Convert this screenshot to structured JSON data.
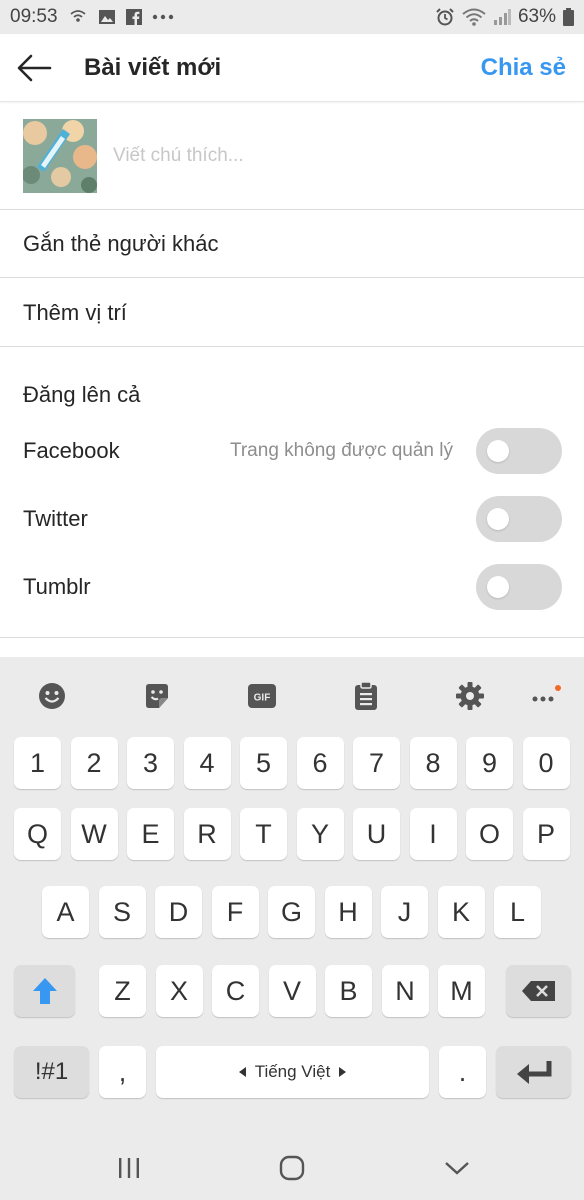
{
  "status_bar": {
    "time": "09:53",
    "battery": "63%",
    "icons_left": [
      "wifi-calling-icon",
      "gallery-icon",
      "facebook-icon",
      "more-notifications-icon"
    ],
    "icons_right": [
      "alarm-icon",
      "wifi-icon",
      "signal-icon",
      "battery-icon"
    ]
  },
  "header": {
    "title": "Bài viết mới",
    "share_label": "Chia sẻ",
    "accent_color": "#3897f0"
  },
  "caption": {
    "placeholder": "Viết chú thích..."
  },
  "rows": {
    "tag_people": "Gắn thẻ người khác",
    "add_location": "Thêm vị trí"
  },
  "share_section": {
    "title": "Đăng lên cả",
    "items": [
      {
        "label": "Facebook",
        "note": "Trang không được quản lý",
        "enabled": false
      },
      {
        "label": "Twitter",
        "note": "",
        "enabled": false
      },
      {
        "label": "Tumblr",
        "note": "",
        "enabled": false
      }
    ]
  },
  "keyboard": {
    "toolbar": [
      "emoji-icon",
      "sticker-icon",
      "gif-icon",
      "clipboard-icon",
      "settings-icon",
      "more-icon"
    ],
    "gif_label": "GIF",
    "row_numbers": [
      "1",
      "2",
      "3",
      "4",
      "5",
      "6",
      "7",
      "8",
      "9",
      "0"
    ],
    "row_top": [
      "Q",
      "W",
      "E",
      "R",
      "T",
      "Y",
      "U",
      "I",
      "O",
      "P"
    ],
    "row_middle": [
      "A",
      "S",
      "D",
      "F",
      "G",
      "H",
      "J",
      "K",
      "L"
    ],
    "row_bottom": [
      "Z",
      "X",
      "C",
      "V",
      "B",
      "N",
      "M"
    ],
    "symbols_label": "!#1",
    "comma_label": ",",
    "space_label": "Tiếng Việt",
    "period_label": "."
  },
  "navbar": [
    "recent-apps-icon",
    "home-icon",
    "back-chevron-icon"
  ]
}
